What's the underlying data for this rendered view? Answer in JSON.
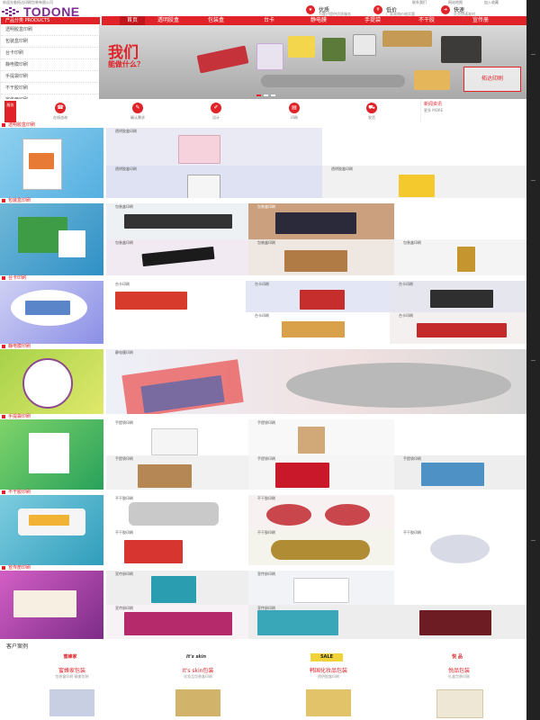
{
  "topbar": {
    "left_text": "欢迎光临拓达印刷包装有限公司",
    "right_links": [
      "联系我们",
      "网站地图",
      "加入收藏"
    ]
  },
  "brand": {
    "name": "TODONE",
    "accent": "#e02328",
    "logo_color": "#7b2d8f"
  },
  "header_links": [
    {
      "label": "优质",
      "sub": "为客户提供优质服务"
    },
    {
      "label": "低价",
      "sub": "厂家直销价格实惠"
    },
    {
      "label": "快速",
      "sub": "交货快速准时"
    }
  ],
  "nav": [
    "首页",
    "透明胶盒",
    "包装盒",
    "台卡",
    "静电膜",
    "手提袋",
    "不干胶",
    "宣传册"
  ],
  "sidebar": {
    "title": "产品分类 PRODUCTS",
    "items": [
      "透明胶盒印刷",
      "包装盒印刷",
      "台卡印刷",
      "静电膜印刷",
      "手提袋印刷",
      "不干胶印刷",
      "宣传册印刷"
    ]
  },
  "banner": {
    "title": "我们",
    "subtitle": "能做什么？",
    "stamp": "拓达印刷"
  },
  "service": {
    "tag": "服务",
    "items": [
      {
        "icon": "phone-icon",
        "label": "在线咨询"
      },
      {
        "icon": "doc-icon",
        "label": "确认需求"
      },
      {
        "icon": "design-icon",
        "label": "设计"
      },
      {
        "icon": "print-icon",
        "label": "印刷"
      },
      {
        "icon": "truck-icon",
        "label": "发货"
      }
    ]
  },
  "news": {
    "title": "新闻资讯",
    "more": "更多 MORE"
  },
  "sections": [
    {
      "title": "透明胶盒印刷",
      "captions": [
        "透明胶盒印刷",
        "透明胶盒印刷",
        "透明胶盒印刷"
      ]
    },
    {
      "title": "包装盒印刷",
      "captions": [
        "包装盒印刷",
        "包装盒印刷",
        "包装盒印刷",
        "包装盒印刷",
        "包装盒印刷"
      ]
    },
    {
      "title": "台卡印刷",
      "captions": [
        "台卡印刷",
        "台卡印刷",
        "台卡印刷",
        "台卡印刷",
        "台卡印刷"
      ]
    },
    {
      "title": "静电膜印刷",
      "captions": [
        "静电膜印刷"
      ]
    },
    {
      "title": "手提袋印刷",
      "captions": [
        "手提袋印刷",
        "手提袋印刷",
        "手提袋印刷",
        "手提袋印刷",
        "手提袋印刷"
      ]
    },
    {
      "title": "不干胶印刷",
      "captions": [
        "不干胶印刷",
        "不干胶印刷",
        "不干胶印刷",
        "不干胶印刷",
        "不干胶印刷"
      ]
    },
    {
      "title": "宣传册印刷",
      "captions": [
        "宣传册印刷",
        "宣传册印刷",
        "宣传册印刷",
        "宣传册印刷"
      ]
    }
  ],
  "cases": {
    "title": "客户案例",
    "items": [
      {
        "logo": "蜜蜂家",
        "name": "蜜蜂家包装",
        "desc": "包装盒印刷 精美包装"
      },
      {
        "logo": "It's skin",
        "name": "It's skin包装",
        "desc": "化妆品包装盒印刷"
      },
      {
        "logo": "SALE",
        "name": "韩国化妆品包装",
        "desc": "透明胶盒印刷"
      },
      {
        "logo": "悦 品",
        "name": "悦品包装",
        "desc": "礼盒包装印刷"
      }
    ]
  }
}
